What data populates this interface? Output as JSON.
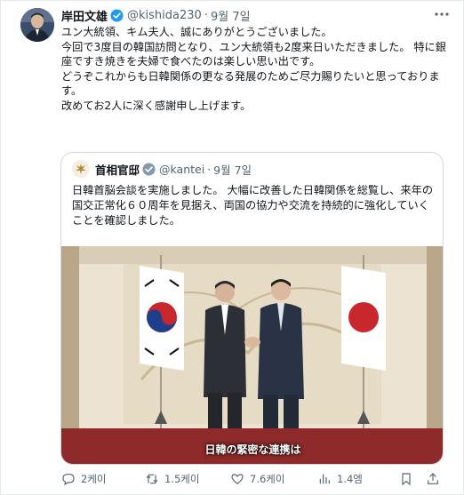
{
  "tweet": {
    "author_name": "岸田文雄",
    "author_handle": "@kishida230",
    "separator": "·",
    "date": "9월 7일",
    "lines": [
      "ユン大統領、キム夫人、誠にありがとうございました。",
      "今回で3度目の韓国訪問となり、ユン大統領も2度来日いただきました。 特に銀座ですき焼きを夫婦で食べたのは楽しい思い出です。",
      "どうぞこれからも日韓関係の更なる発展のためご尽力賜りたいと思っております。",
      "改めてお2人に深く感謝申し上げます。"
    ]
  },
  "quote": {
    "author_name": "首相官邸",
    "author_handle": "@kantei",
    "separator": "·",
    "date": "9월 7일",
    "text": "日韓首脳会談を実施しました。 大幅に改善した日韓関係を総覧し、来年の国交正常化６０周年を見据え、両国の協力や交流を持続的に強化していくことを確認しました。",
    "image_caption": "日韓の緊密な連携は"
  },
  "actions": {
    "reply_count": "2케이",
    "retweet_count": "1.5케이",
    "like_count": "7.6케이",
    "view_count": "1.4엠"
  },
  "icons": {
    "verified": "verified-badge-icon",
    "more": "more-options-icon",
    "reply": "reply-icon",
    "retweet": "retweet-icon",
    "like": "heart-icon",
    "views": "views-chart-icon",
    "bookmark": "bookmark-icon",
    "share": "share-icon"
  },
  "colors": {
    "verified_blue": "#1d9bf0",
    "text_secondary": "#536471",
    "border": "#cfd9de"
  }
}
